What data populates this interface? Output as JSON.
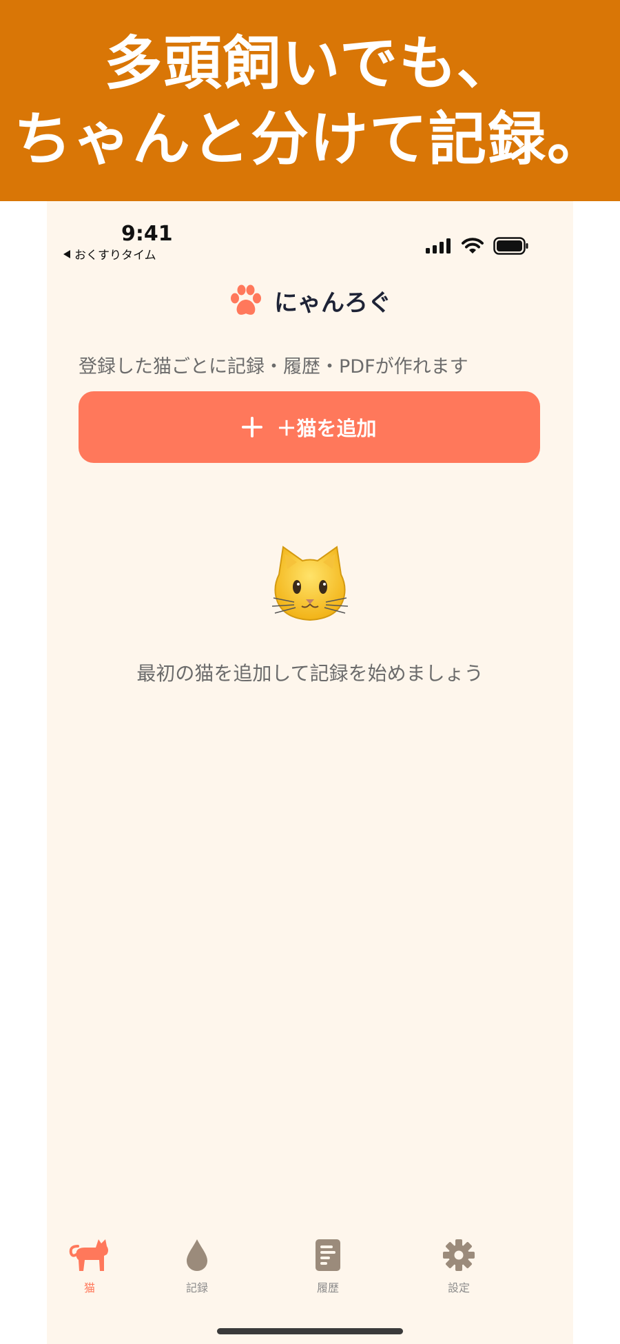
{
  "banner": {
    "line1": "多頭飼いでも、",
    "line2": "ちゃんと分けて記録。",
    "background": "#d97606"
  },
  "status_bar": {
    "time": "9:41",
    "back_app": "おくすりタイム"
  },
  "header": {
    "title": "にゃんろぐ",
    "icon": "paw-icon"
  },
  "subtitle": "登録した猫ごとに記録・履歴・PDFが作れます",
  "add_button": {
    "label": "＋猫を追加",
    "icon": "plus-icon",
    "color": "#ff785b"
  },
  "empty_state": {
    "icon": "cat-face-icon",
    "message": "最初の猫を追加して記録を始めましょう"
  },
  "tabs": [
    {
      "label": "猫",
      "icon": "cat-icon",
      "active": true
    },
    {
      "label": "記録",
      "icon": "drop-icon",
      "active": false
    },
    {
      "label": "履歴",
      "icon": "document-icon",
      "active": false
    },
    {
      "label": "設定",
      "icon": "gear-icon",
      "active": false
    }
  ],
  "colors": {
    "accent": "#ff785b",
    "background": "#fef6ec",
    "title": "#1e2336",
    "muted": "#6b6b6b",
    "tab_inactive": "#8c8c8c"
  }
}
